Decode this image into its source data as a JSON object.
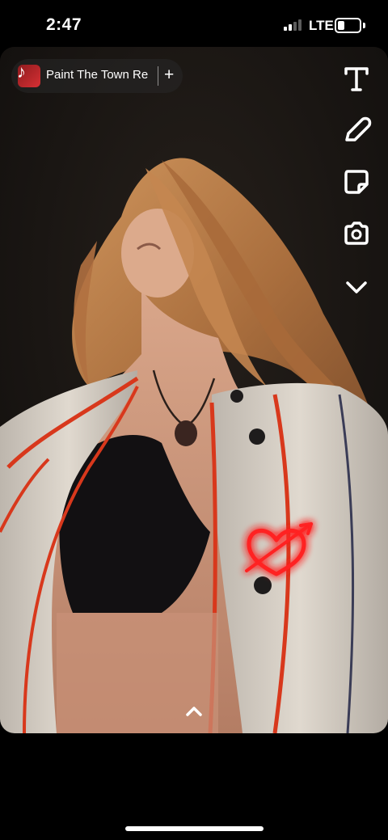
{
  "status_bar": {
    "time": "2:47",
    "network": "LTE",
    "signal_bars": 4,
    "signal_bars_active": 2,
    "battery_level": 0.2
  },
  "music_sticker": {
    "title": "Paint The Town Red",
    "add_label": "+",
    "icon": "music-note-icon"
  },
  "toolbar": {
    "tools": [
      "text-tool-icon",
      "pencil-icon",
      "sticker-icon",
      "camera-lens-icon",
      "chevron-down-icon"
    ]
  },
  "stickers": {
    "heart": "heart-arrow-sticker",
    "color": "#ff2020"
  },
  "swipe_up": "chevron-up-icon",
  "colors": {
    "sticker_red": "#ff2020",
    "background": "#000000"
  }
}
